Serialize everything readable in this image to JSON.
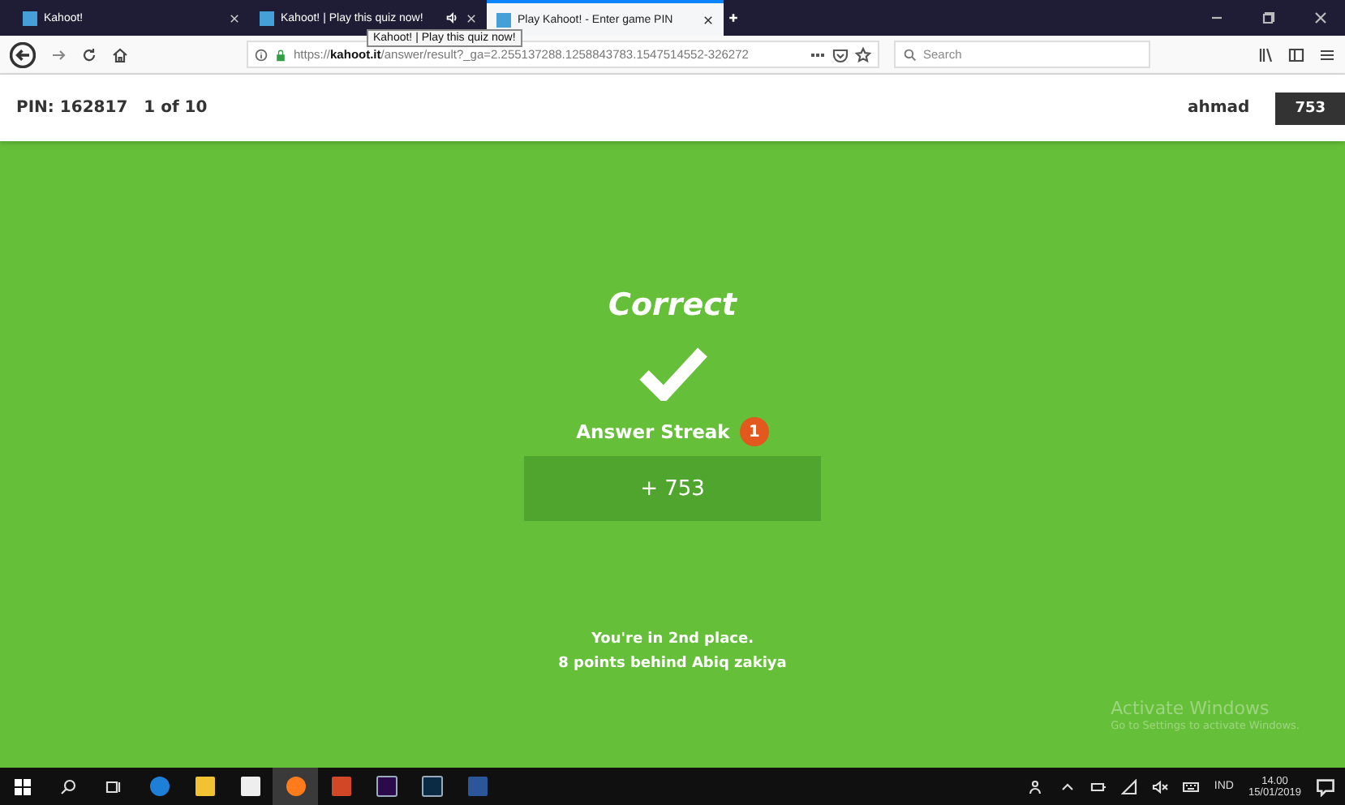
{
  "browser": {
    "tabs": [
      {
        "title": "Kahoot!",
        "selected": false,
        "audio": false
      },
      {
        "title": "Kahoot! | Play this quiz now!",
        "selected": false,
        "audio": true
      },
      {
        "title": "Play Kahoot! - Enter game PIN",
        "selected": true,
        "audio": false
      }
    ],
    "tooltip": "Kahoot! | Play this quiz now!",
    "url": {
      "prefix": "https://",
      "host": "kahoot.it",
      "path": "/answer/result?_ga=2.255137288.1258843783.1547514552-326272"
    },
    "search": {
      "placeholder": "Search"
    }
  },
  "header": {
    "pin": "PIN: 162817",
    "progress": "1 of 10",
    "player": "ahmad",
    "score": "753"
  },
  "result": {
    "title": "Correct",
    "streak_label": "Answer Streak",
    "streak": "1",
    "points": "+ 753",
    "place": "You're in **2nd place**.",
    "behind": "8 points behind Abiq zakiya"
  },
  "os_notice": {
    "title": "Activate Windows",
    "subtitle": "Go to Settings to activate Windows."
  },
  "taskbar": {
    "apps": [
      {
        "kind": "edge",
        "selected": false
      },
      {
        "kind": "files",
        "selected": false
      },
      {
        "kind": "store",
        "selected": false
      },
      {
        "kind": "firefox",
        "selected": true
      },
      {
        "kind": "powerpoint",
        "selected": false
      },
      {
        "kind": "premiere",
        "selected": false
      },
      {
        "kind": "photoshop",
        "selected": false
      },
      {
        "kind": "word",
        "selected": false
      }
    ],
    "language": "IND",
    "time": "14.00",
    "date": "15/01/2019"
  }
}
